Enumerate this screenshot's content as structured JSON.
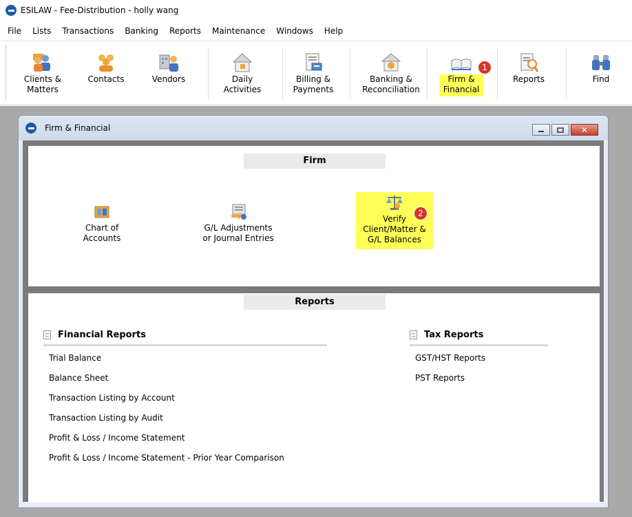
{
  "app": {
    "title": "ESILAW - Fee-Distribution - holly wang",
    "logo_icon": "scales-icon"
  },
  "menu": [
    "File",
    "Lists",
    "Transactions",
    "Banking",
    "Reports",
    "Maintenance",
    "Windows",
    "Help"
  ],
  "toolbar": {
    "buttons": [
      {
        "label": "Clients &\nMatters",
        "icon": "clients-matters-icon"
      },
      {
        "label": "Contacts",
        "icon": "contacts-icon"
      },
      {
        "label": "Vendors",
        "icon": "vendors-icon"
      },
      {
        "label": "Daily\nActivities",
        "icon": "house-icon"
      },
      {
        "label": "Billing &\nPayments",
        "icon": "billing-icon"
      },
      {
        "label": "Banking &\nReconciliation",
        "icon": "bank-icon"
      },
      {
        "label": "Firm &\nFinancial",
        "icon": "open-book-icon"
      },
      {
        "label": "Reports",
        "icon": "reports-magnifier-icon"
      },
      {
        "label": "Find",
        "icon": "binoculars-icon"
      }
    ],
    "highlight_color": "#ffff57"
  },
  "badges": {
    "first": "1",
    "second": "2",
    "color": "#d9332c"
  },
  "child_window": {
    "title": "Firm & Financial",
    "controls": {
      "minimize": "minimize-icon",
      "restore": "restore-icon",
      "close": "close-icon"
    }
  },
  "firm": {
    "header": "Firm",
    "items": [
      {
        "label": "Chart of\nAccounts",
        "icon": "chart-of-accounts-icon"
      },
      {
        "label": "G/L Adjustments\nor Journal Entries",
        "icon": "journal-entries-icon"
      },
      {
        "label": "Verify\nClient/Matter &\nG/L Balances",
        "icon": "balance-scale-icon"
      }
    ]
  },
  "reports": {
    "header": "Reports",
    "financial": {
      "title": "Financial Reports",
      "items": [
        "Trial Balance",
        "Balance Sheet",
        "Transaction Listing by Account",
        "Transaction Listing by Audit",
        "Profit & Loss / Income Statement",
        "Profit & Loss / Income Statement - Prior Year Comparison"
      ]
    },
    "tax": {
      "title": "Tax Reports",
      "items": [
        "GST/HST Reports",
        "PST Reports"
      ]
    }
  }
}
